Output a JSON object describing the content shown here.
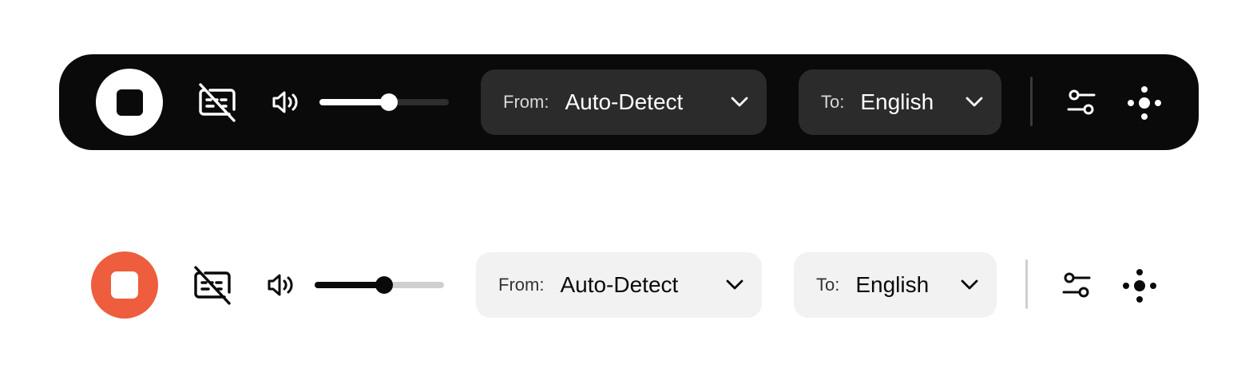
{
  "colors": {
    "dark_bar": "#0a0a0a",
    "dark_dropdown": "#2b2b2b",
    "light_dropdown": "#f2f2f2",
    "record_accent": "#ee5d3e"
  },
  "toolbars": [
    {
      "theme": "dark",
      "record_icon": "stop-square-icon",
      "captions_icon": "captions-off-icon",
      "volume_icon": "speaker-icon",
      "volume_level": 0.54,
      "from": {
        "label": "From:",
        "value": "Auto-Detect"
      },
      "to": {
        "label": "To:",
        "value": "English"
      },
      "settings_icon": "sliders-icon",
      "more_icon": "dots-cluster-icon"
    },
    {
      "theme": "light",
      "record_icon": "stop-square-icon",
      "captions_icon": "captions-off-icon",
      "volume_icon": "speaker-icon",
      "volume_level": 0.54,
      "from": {
        "label": "From:",
        "value": "Auto-Detect"
      },
      "to": {
        "label": "To:",
        "value": "English"
      },
      "settings_icon": "sliders-icon",
      "more_icon": "dots-cluster-icon"
    }
  ]
}
